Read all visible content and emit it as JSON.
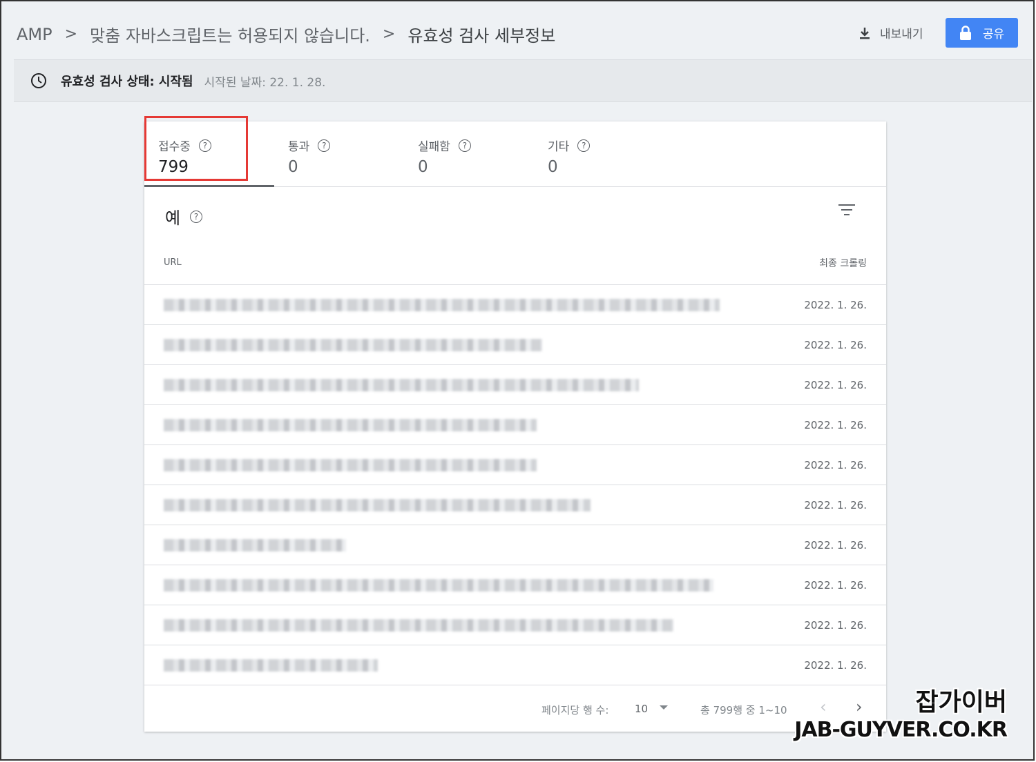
{
  "breadcrumb": [
    "AMP",
    "맞춤 자바스크립트는 허용되지 않습니다.",
    "유효성 검사 세부정보"
  ],
  "header": {
    "export_label": "내보내기",
    "share_label": "공유"
  },
  "status": {
    "label": "유효성 검사 상태: 시작됨",
    "date": "시작된 날짜: 22. 1. 28."
  },
  "tabs": [
    {
      "label": "접수중",
      "count": "799"
    },
    {
      "label": "통과",
      "count": "0"
    },
    {
      "label": "실패함",
      "count": "0"
    },
    {
      "label": "기타",
      "count": "0"
    }
  ],
  "examples": {
    "title": "예",
    "col_url": "URL",
    "col_crawl": "최종 크롤링"
  },
  "rows": [
    {
      "crawl": "2022. 1. 26."
    },
    {
      "crawl": "2022. 1. 26."
    },
    {
      "crawl": "2022. 1. 26."
    },
    {
      "crawl": "2022. 1. 26."
    },
    {
      "crawl": "2022. 1. 26."
    },
    {
      "crawl": "2022. 1. 26."
    },
    {
      "crawl": "2022. 1. 26."
    },
    {
      "crawl": "2022. 1. 26."
    },
    {
      "crawl": "2022. 1. 26."
    },
    {
      "crawl": "2022. 1. 26."
    }
  ],
  "pager": {
    "rows_per_page_label": "페이지당 행 수:",
    "rows_per_page": "10",
    "range": "총 799행 중 1~10"
  },
  "watermark": {
    "line1": "잡가이버",
    "line2": "JAB-GUYVER.CO.KR"
  },
  "colors": {
    "accent": "#4285f4",
    "highlight": "#e53935"
  }
}
